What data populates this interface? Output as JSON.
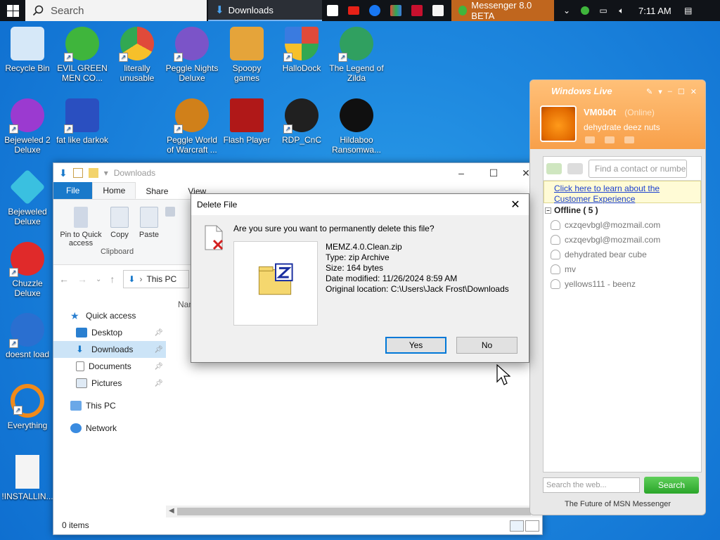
{
  "taskbar": {
    "search_placeholder": "Search",
    "downloads_task": "Downloads",
    "messenger_task": "Messenger 8.0 BETA",
    "clock": "7:11 AM"
  },
  "desktop_icons": [
    {
      "label": "Recycle Bin",
      "color": "#cfe3f5"
    },
    {
      "label": "EVIL GREEN MEN CO...",
      "color": "#3fb53c"
    },
    {
      "label": "literally unusable",
      "color": "#e04a3a"
    },
    {
      "label": "Peggle Nights Deluxe",
      "color": "#7b54c8"
    },
    {
      "label": "Spoopy games",
      "color": "#e5a43a"
    },
    {
      "label": "HalloDock",
      "color": "#3a7be0"
    },
    {
      "label": "The Legend of Zilda",
      "color": "#30a060"
    },
    {
      "label": "Bejeweled 2 Deluxe",
      "color": "#9b3ad0"
    },
    {
      "label": "fat like darkok",
      "color": "#2a4fc0"
    },
    {
      "label": "Peggle World of Warcraft ...",
      "color": "#d0801a"
    },
    {
      "label": "Flash Player",
      "color": "#b01818"
    },
    {
      "label": "RDP_CnC",
      "color": "#202020"
    },
    {
      "label": "Hildaboo Ransomwa...",
      "color": "#101010"
    },
    {
      "label": "Bejeweled Deluxe",
      "color": "#3ac0e0"
    },
    {
      "label": "Chuzzle Deluxe",
      "color": "#e02a2a"
    },
    {
      "label": "doesnt load",
      "color": "#2a6fd0"
    },
    {
      "label": "Everything",
      "color": "#f08a1a"
    },
    {
      "label": "!INSTALLIN...",
      "color": "#f4f4f4"
    }
  ],
  "explorer": {
    "title": "Downloads",
    "tabs": [
      "File",
      "Home",
      "Share",
      "View"
    ],
    "ribbon": {
      "pin": "Pin to Quick access",
      "copy": "Copy",
      "paste": "Paste",
      "group": "Clipboard"
    },
    "address": "This PC",
    "column_name": "Nam",
    "nav": [
      {
        "label": "Quick access"
      },
      {
        "label": "Desktop"
      },
      {
        "label": "Downloads"
      },
      {
        "label": "Documents"
      },
      {
        "label": "Pictures"
      },
      {
        "label": "This PC"
      },
      {
        "label": "Network"
      }
    ],
    "status": "0 items"
  },
  "dialog": {
    "title": "Delete File",
    "question": "Are you sure you want to permanently delete this file?",
    "file_name": "MEMZ.4.0.Clean.zip",
    "file_type": "Type: zip Archive",
    "file_size": "Size: 164 bytes",
    "file_date": "Date modified: 11/26/2024 8:59 AM",
    "file_location": "Original location: C:\\Users\\Jack Frost\\Downloads",
    "yes": "Yes",
    "no": "No"
  },
  "messenger": {
    "brand": "Windows Live",
    "user_name": "VM0b0t",
    "status": "(Online)",
    "personal_message": "dehydrate deez nuts",
    "find_placeholder": "Find a contact or number",
    "banner": "Click here to learn about the Customer Experience",
    "group": "Offline ( 5 )",
    "contacts": [
      "cxzqevbgl@mozmail.com",
      "cxzqevbgl@mozmail.com",
      "dehydrated bear cube",
      "mv",
      "yellows111 - beenz"
    ],
    "web_placeholder": "Search the web...",
    "search_button": "Search",
    "footer": "The Future of MSN Messenger"
  }
}
